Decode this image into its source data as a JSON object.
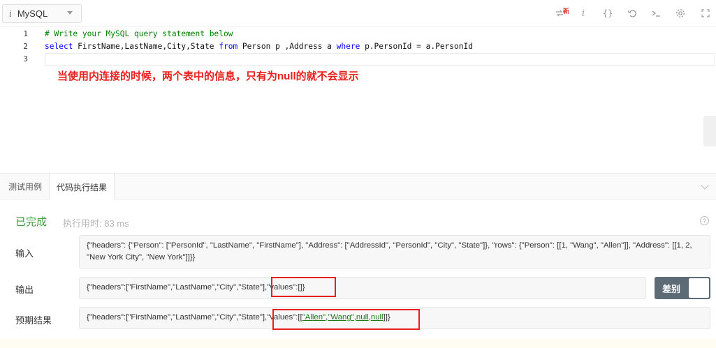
{
  "toolbar": {
    "language": "MySQL",
    "language_info_glyph": "i",
    "new_badge": "新",
    "icons": [
      "format-icon",
      "info-icon",
      "braces-icon",
      "reset-icon",
      "console-icon",
      "settings-icon",
      "fullscreen-icon"
    ]
  },
  "editor": {
    "line_numbers": [
      "1",
      "2",
      "3"
    ],
    "line1_comment": "# Write your MySQL query statement below",
    "line2": {
      "t1": "select",
      "t2": " FirstName,LastName,City,State ",
      "t3": "from",
      "t4": " Person p ,Address a ",
      "t5": "where",
      "t6": " p.PersonId = a.PersonId"
    },
    "annotation": "当使用内连接的时候，两个表中的信息，只有为null的就不会显示"
  },
  "tabs": [
    "测试用例",
    "代码执行结果"
  ],
  "results": {
    "status": "已完成",
    "runtime": "执行用时: 83 ms",
    "help_glyph": "?",
    "input_label": "输入",
    "input_value": "{\"headers\": {\"Person\": [\"PersonId\", \"LastName\", \"FirstName\"], \"Address\": [\"AddressId\", \"PersonId\", \"City\", \"State\"]}, \"rows\": {\"Person\": [[1, \"Wang\", \"Allen\"]], \"Address\": [[1, 2, \"New York City\", \"New York\"]]}}",
    "output_label": "输出",
    "output_value": "{\"headers\":[\"FirstName\",\"LastName\",\"City\",\"State\"],\"values\":[]}",
    "expected_label": "预期结果",
    "expected_prefix": "{\"headers\":[\"FirstName\",\"LastName\",\"City\",\"State\"],\"values\":[[",
    "expected_allen": "\"Allen\"",
    "expected_comma1": ",",
    "expected_wang": "\"Wang\"",
    "expected_comma2": ",",
    "expected_null1": "null",
    "expected_comma3": ",",
    "expected_null2": "null",
    "expected_suffix": "]]}",
    "diff_label": "差别"
  },
  "colors": {
    "status_green": "#3a9d3a",
    "annotation_red": "#e8201d",
    "diff_button": "#5d6b77"
  }
}
